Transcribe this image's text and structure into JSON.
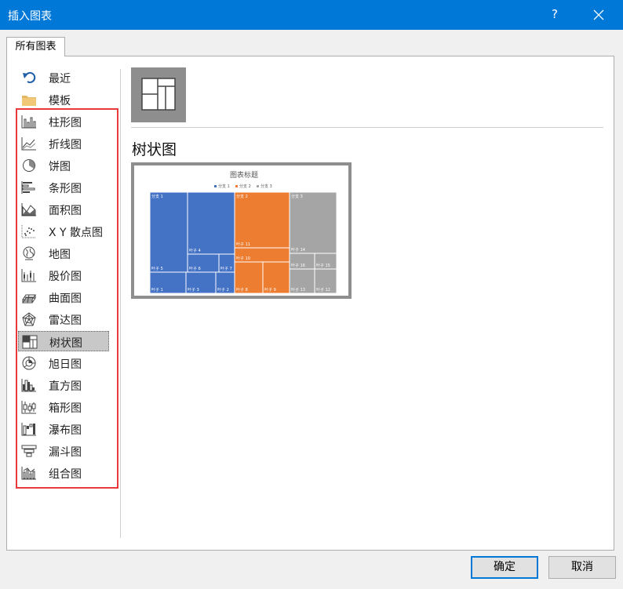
{
  "window": {
    "title": "插入图表",
    "help_label": "?"
  },
  "tabs": [
    {
      "label": "所有图表"
    }
  ],
  "sidebar": {
    "items": [
      {
        "label": "最近",
        "icon": "undo-icon"
      },
      {
        "label": "模板",
        "icon": "folder-icon"
      },
      {
        "label": "柱形图",
        "icon": "column-chart-icon"
      },
      {
        "label": "折线图",
        "icon": "line-chart-icon"
      },
      {
        "label": "饼图",
        "icon": "pie-chart-icon"
      },
      {
        "label": "条形图",
        "icon": "bar-chart-icon"
      },
      {
        "label": "面积图",
        "icon": "area-chart-icon"
      },
      {
        "label": "X Y 散点图",
        "icon": "scatter-chart-icon"
      },
      {
        "label": "地图",
        "icon": "map-chart-icon"
      },
      {
        "label": "股价图",
        "icon": "stock-chart-icon"
      },
      {
        "label": "曲面图",
        "icon": "surface-chart-icon"
      },
      {
        "label": "雷达图",
        "icon": "radar-chart-icon"
      },
      {
        "label": "树状图",
        "icon": "treemap-chart-icon",
        "selected": true
      },
      {
        "label": "旭日图",
        "icon": "sunburst-chart-icon"
      },
      {
        "label": "直方图",
        "icon": "histogram-chart-icon"
      },
      {
        "label": "箱形图",
        "icon": "box-whisker-chart-icon"
      },
      {
        "label": "瀑布图",
        "icon": "waterfall-chart-icon"
      },
      {
        "label": "漏斗图",
        "icon": "funnel-chart-icon"
      },
      {
        "label": "组合图",
        "icon": "combo-chart-icon"
      }
    ]
  },
  "main": {
    "chart_type_title": "树状图",
    "preview": {
      "title": "图表标题",
      "legend": [
        "分支 1",
        "分支 2",
        "分支 3"
      ],
      "cells": [
        {
          "label": "分支 1",
          "branch": 1
        },
        {
          "label": "叶子 4",
          "branch": 1
        },
        {
          "label": "叶子 5",
          "branch": 1
        },
        {
          "label": "叶子 6",
          "branch": 1
        },
        {
          "label": "叶子 7",
          "branch": 1
        },
        {
          "label": "叶子 1",
          "branch": 1
        },
        {
          "label": "叶子 3",
          "branch": 1
        },
        {
          "label": "叶子 2",
          "branch": 1
        },
        {
          "label": "分支 2",
          "branch": 2
        },
        {
          "label": "叶子 11",
          "branch": 2
        },
        {
          "label": "叶子 10",
          "branch": 2
        },
        {
          "label": "叶子 8",
          "branch": 2
        },
        {
          "label": "叶子 9",
          "branch": 2
        },
        {
          "label": "分支 3",
          "branch": 3
        },
        {
          "label": "叶子 14",
          "branch": 3
        },
        {
          "label": "叶子 16",
          "branch": 3
        },
        {
          "label": "叶子 15",
          "branch": 3
        },
        {
          "label": "叶子 13",
          "branch": 3
        },
        {
          "label": "叶子 12",
          "branch": 3
        }
      ]
    }
  },
  "buttons": {
    "ok": "确定",
    "cancel": "取消"
  },
  "colors": {
    "titlebar": "#0078d7",
    "branch1": "#4472c4",
    "branch2": "#ed7d31",
    "branch3": "#a5a5a5",
    "highlight_box": "#e8393b"
  }
}
